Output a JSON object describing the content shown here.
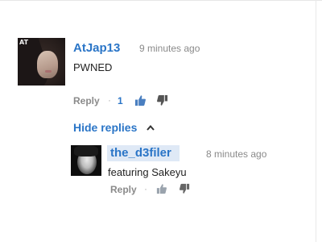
{
  "comments": [
    {
      "author": "AtJap13",
      "avatar_tag": "AT",
      "time": "9 minutes ago",
      "text": "PWNED",
      "actions": {
        "reply_label": "Reply",
        "separator": "·",
        "like_count": "1"
      }
    }
  ],
  "replies_toggle": {
    "label": "Hide replies",
    "icon": "chevron-up-icon"
  },
  "replies": [
    {
      "author": "the_d3filer",
      "time": "8 minutes ago",
      "text": "featuring Sakeyu",
      "actions": {
        "reply_label": "Reply",
        "separator": "·"
      }
    }
  ],
  "colors": {
    "author_link": "#2a75c7",
    "meta_gray": "#8a8a8a",
    "like_active": "#4a7fc0",
    "dislike": "#555555",
    "highlight": "#dfe9f6"
  }
}
